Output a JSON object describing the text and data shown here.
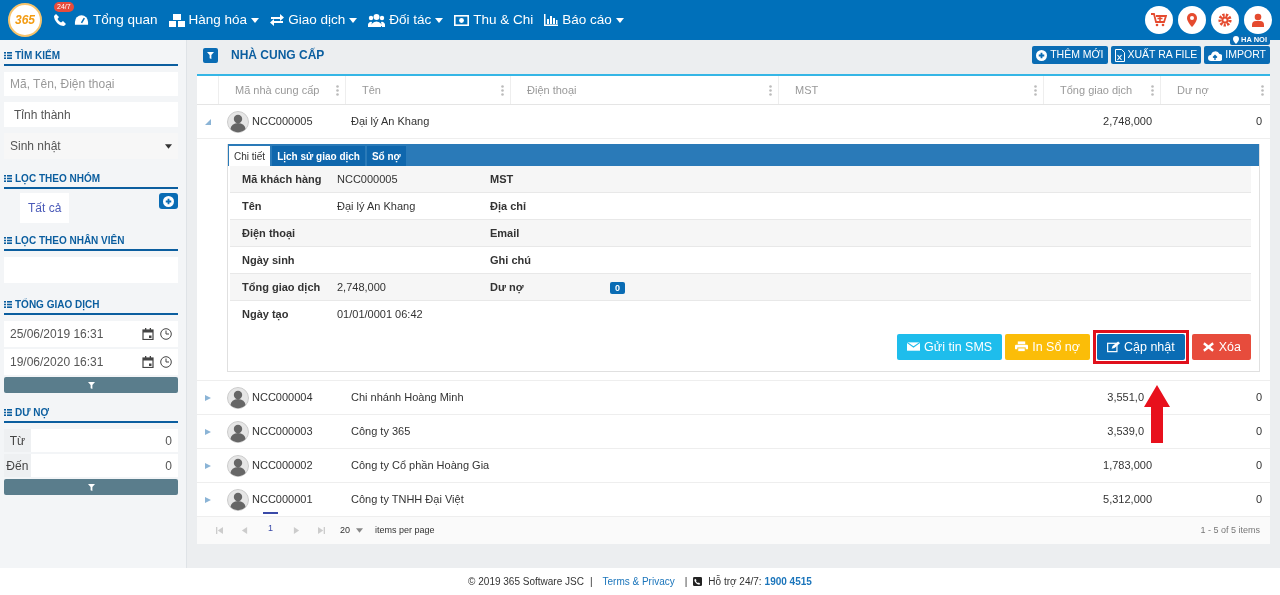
{
  "nav": {
    "logo": "365",
    "hotline_badge": "24/7",
    "menu": [
      {
        "label": "Tổng quan",
        "kind": "dashboard",
        "dropdown": false
      },
      {
        "label": "Hàng hóa",
        "kind": "products",
        "dropdown": true
      },
      {
        "label": "Giao dịch",
        "kind": "transactions",
        "dropdown": true
      },
      {
        "label": "Đối tác",
        "kind": "partners",
        "dropdown": true
      },
      {
        "label": "Thu & Chi",
        "kind": "cashbook",
        "dropdown": false
      },
      {
        "label": "Báo cáo",
        "kind": "reports",
        "dropdown": true
      }
    ]
  },
  "sidebar": {
    "search": {
      "title": "TÌM KIẾM",
      "placeholder": "Mã, Tên, Điện thoại",
      "province": "Tỉnh thành",
      "birthday": "Sinh nhật"
    },
    "group_filter": {
      "title": "LỌC THEO NHÓM",
      "items": [
        {
          "label": "Tất cả",
          "selected": true
        }
      ]
    },
    "staff_filter": {
      "title": "LỌC THEO NHÂN VIÊN"
    },
    "transactions": {
      "title": "TỔNG GIAO DỊCH",
      "from": "25/06/2019 16:31",
      "to": "19/06/2020 16:31"
    },
    "debt": {
      "title": "DƯ NỢ",
      "from_label": "Từ",
      "from_value": "0",
      "to_label": "Đến",
      "to_value": "0"
    }
  },
  "page": {
    "title": "NHÀ CUNG CẤP",
    "location": "HA NOI",
    "actions": [
      {
        "label": "THÊM MỚI",
        "kind": "add"
      },
      {
        "label": "XUẤT RA FILE",
        "kind": "export"
      },
      {
        "label": "IMPORT",
        "kind": "import"
      }
    ]
  },
  "table": {
    "columns": [
      "Mã nhà cung cấp",
      "Tên",
      "Điện thoại",
      "MST",
      "Tổng giao dịch",
      "Dư nợ"
    ],
    "rows": [
      {
        "code": "NCC000005",
        "name": "Đại lý An Khang",
        "total": "2,748,000",
        "debt": "0",
        "expanded": true
      },
      {
        "code": "NCC000004",
        "name": "Chi nhánh Hoàng Minh",
        "total": "3,551,0",
        "debt": "0",
        "expanded": false
      },
      {
        "code": "NCC000003",
        "name": "Công ty 365",
        "total": "3,539,0",
        "debt": "0",
        "expanded": false
      },
      {
        "code": "NCC000002",
        "name": "Công ty Cổ phần Hoàng Gia",
        "total": "1,783,000",
        "debt": "0",
        "expanded": false
      },
      {
        "code": "NCC000001",
        "name": "Công ty TNHH Đại Việt",
        "total": "5,312,000",
        "debt": "0",
        "expanded": false
      }
    ],
    "detail": {
      "tabs": [
        {
          "label": "Chi tiết",
          "selected": true
        },
        {
          "label": "Lịch sử giao dịch",
          "selected": false
        },
        {
          "label": "Sổ nợ",
          "selected": false
        }
      ],
      "fields": [
        [
          {
            "label": "Mã khách hàng",
            "value": "NCC000005"
          },
          {
            "label": "MST"
          }
        ],
        [
          {
            "label": "Tên",
            "value": "Đại lý An Khang"
          },
          {
            "label": "Địa chỉ"
          }
        ],
        [
          {
            "label": "Điện thoại"
          },
          {
            "label": "Email"
          }
        ],
        [
          {
            "label": "Ngày sinh"
          },
          {
            "label": "Ghi chú"
          }
        ],
        [
          {
            "label": "Tổng giao dịch",
            "value": "2,748,000"
          },
          {
            "label": "Dư nợ",
            "value": "0",
            "kind": "badge"
          }
        ],
        [
          {
            "label": "Ngày tạo",
            "value": "01/01/0001 06:42"
          }
        ]
      ],
      "buttons": [
        {
          "label": "Gửi tin SMS",
          "kind": "sms",
          "highlighted": false
        },
        {
          "label": "In Sổ nợ",
          "kind": "print",
          "highlighted": false
        },
        {
          "label": "Cập nhật",
          "kind": "update",
          "highlighted": true
        },
        {
          "label": "Xóa",
          "kind": "delete",
          "highlighted": false
        }
      ]
    },
    "pager": {
      "page": "1",
      "page_size": "20",
      "per_page_label": "items per page",
      "summary": "1 - 5 of 5 items"
    }
  },
  "footer": {
    "copyright": "© 2019 365 Software JSC",
    "separator_1": "|",
    "link": "Terms & Privacy",
    "separator_2": "|",
    "support_label": "Hỗ trợ 24/7:",
    "phone": "1900 4515"
  }
}
